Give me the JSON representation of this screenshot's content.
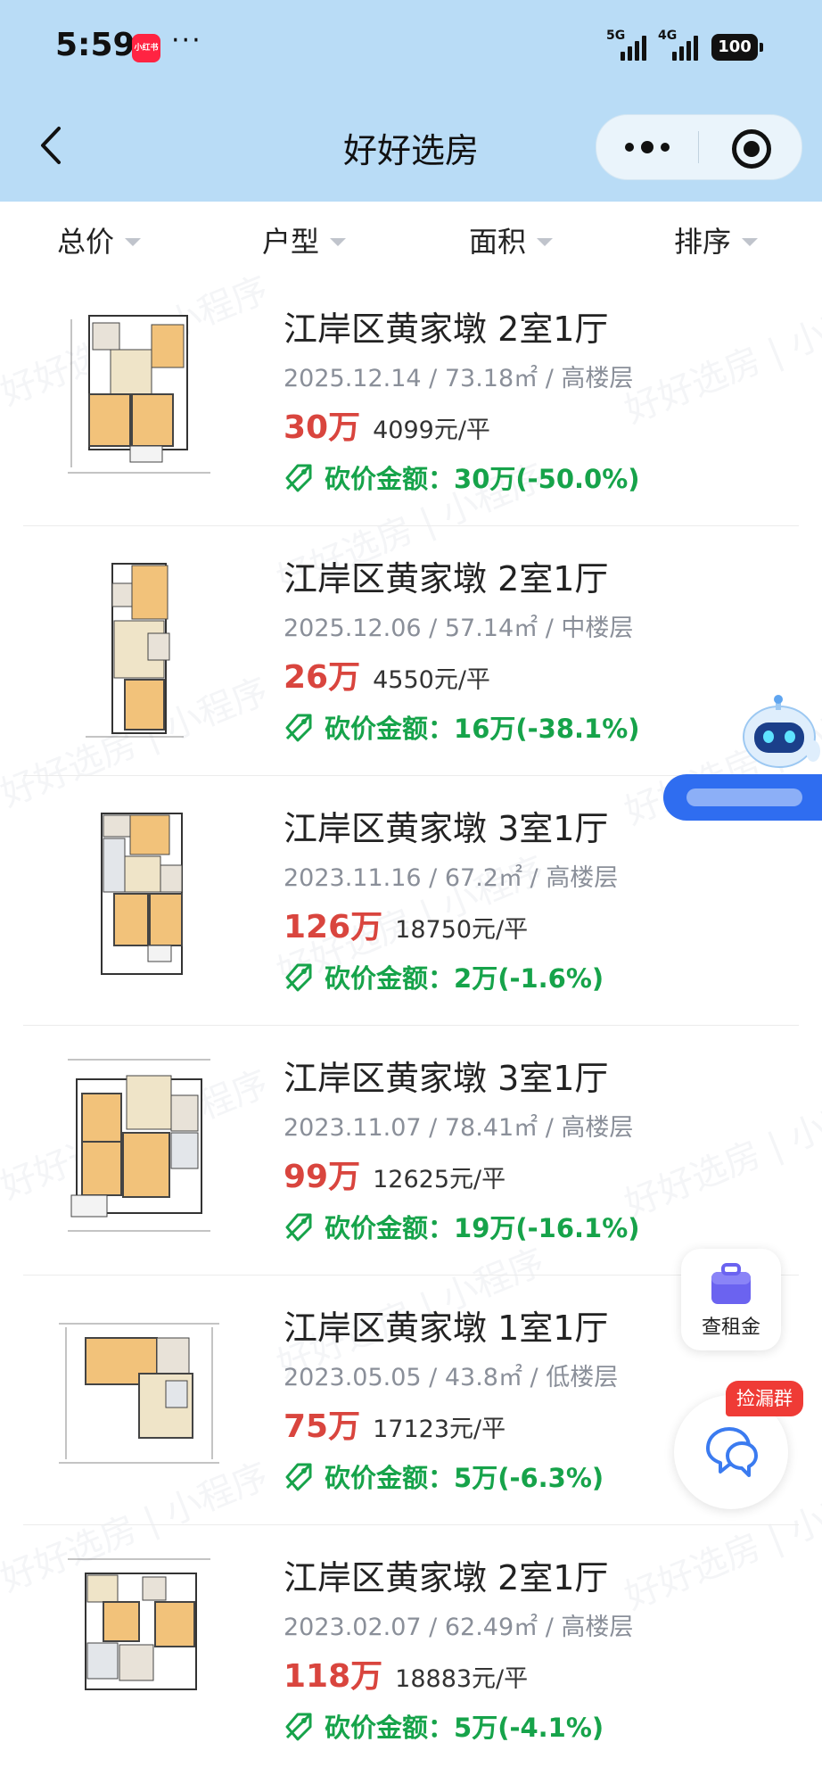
{
  "status_bar": {
    "time": "5:59",
    "app_badge": "小红书",
    "dots": "···",
    "net1": "5G",
    "net2": "4G",
    "battery": "100"
  },
  "nav": {
    "title": "好好选房",
    "back_icon": "chevron-left-icon",
    "more_icon": "more-dots-icon",
    "close_icon": "target-close-icon"
  },
  "filters": [
    {
      "label": "总价"
    },
    {
      "label": "户型"
    },
    {
      "label": "面积"
    },
    {
      "label": "排序"
    }
  ],
  "listings": [
    {
      "title": "江岸区黄家墩 2室1厅",
      "meta": "2025.12.14 / 73.18㎡ / 高楼层",
      "price": "30万",
      "unit_price": "4099元/平",
      "cut_label": "砍价金额：",
      "cut_value": "30万(-50.0%)"
    },
    {
      "title": "江岸区黄家墩 2室1厅",
      "meta": "2025.12.06 / 57.14㎡ / 中楼层",
      "price": "26万",
      "unit_price": "4550元/平",
      "cut_label": "砍价金额：",
      "cut_value": "16万(-38.1%)"
    },
    {
      "title": "江岸区黄家墩 3室1厅",
      "meta": "2023.11.16 / 67.2㎡ / 高楼层",
      "price": "126万",
      "unit_price": "18750元/平",
      "cut_label": "砍价金额：",
      "cut_value": "2万(-1.6%)"
    },
    {
      "title": "江岸区黄家墩 3室1厅",
      "meta": "2023.11.07 / 78.41㎡ / 高楼层",
      "price": "99万",
      "unit_price": "12625元/平",
      "cut_label": "砍价金额：",
      "cut_value": "19万(-16.1%)"
    },
    {
      "title": "江岸区黄家墩 1室1厅",
      "meta": "2023.05.05 / 43.8㎡ / 低楼层",
      "price": "75万",
      "unit_price": "17123元/平",
      "cut_label": "砍价金额：",
      "cut_value": "5万(-6.3%)"
    },
    {
      "title": "江岸区黄家墩 2室1厅",
      "meta": "2023.02.07 / 62.49㎡ / 高楼层",
      "price": "118万",
      "unit_price": "18883元/平",
      "cut_label": "砍价金额：",
      "cut_value": "5万(-4.1%)"
    }
  ],
  "watermark": "好好选房 | 小程序",
  "floating": {
    "rent_label": "查租金",
    "group_badge": "捡漏群",
    "rent_icon": "bag-icon",
    "chat_icon": "chat-bubbles-icon",
    "robot_icon": "robot-assistant-icon"
  },
  "colors": {
    "header_bg": "#b9dcf6",
    "price_red": "#d9453e",
    "cut_green": "#16a34a",
    "meta_gray": "#8a8f99"
  }
}
